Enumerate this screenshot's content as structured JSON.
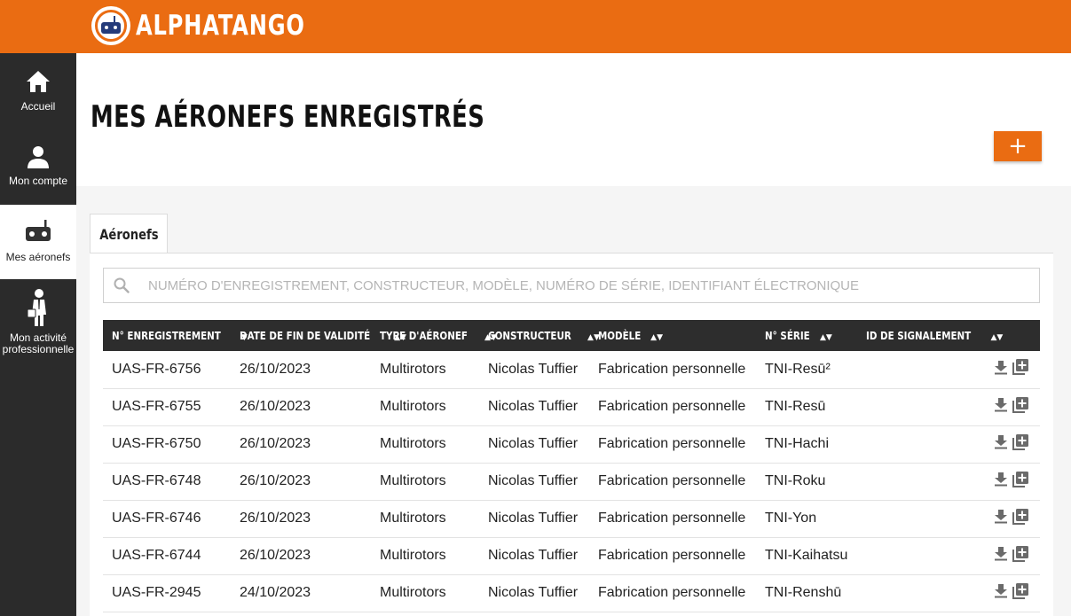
{
  "header": {
    "brand": "ALPHATANGO"
  },
  "sidebar": {
    "items": [
      {
        "label": "Accueil",
        "icon": "home-icon"
      },
      {
        "label": "Mon compte",
        "icon": "user-icon"
      },
      {
        "label": "Mes aéronefs",
        "icon": "drone-controller-icon",
        "active": true
      },
      {
        "label_line1": "Mon activité",
        "label_line2": "professionnelle",
        "icon": "businessman-icon"
      }
    ]
  },
  "page": {
    "title": "MES AÉRONEFS ENREGISTRÉS",
    "add_label": "+"
  },
  "tabs": [
    {
      "label": "Aéronefs"
    }
  ],
  "search": {
    "placeholder": "NUMÉRO D'ENREGISTREMENT, CONSTRUCTEUR, MODÈLE, NUMÉRO DE SÉRIE, IDENTIFIANT ÉLECTRONIQUE"
  },
  "table": {
    "columns": [
      {
        "label": "N° ENREGISTREMENT",
        "sort": "▼"
      },
      {
        "label": "DATE DE FIN DE VALIDITÉ",
        "sort": "▲▼"
      },
      {
        "label": "TYPE D'AÉRONEF",
        "sort": "▲▼"
      },
      {
        "label": "CONSTRUCTEUR",
        "sort": "▲▼"
      },
      {
        "label": "MODÈLE",
        "sort": "▲▼"
      },
      {
        "label": "N° SÉRIE",
        "sort": "▲▼"
      },
      {
        "label": "ID DE SIGNALEMENT",
        "sort": "▲▼"
      }
    ],
    "rows": [
      [
        "UAS-FR-6756",
        "26/10/2023",
        "Multirotors",
        "Nicolas Tuffier",
        "Fabrication personnelle",
        "TNI-Resū²",
        ""
      ],
      [
        "UAS-FR-6755",
        "26/10/2023",
        "Multirotors",
        "Nicolas Tuffier",
        "Fabrication personnelle",
        "TNI-Resū",
        ""
      ],
      [
        "UAS-FR-6750",
        "26/10/2023",
        "Multirotors",
        "Nicolas Tuffier",
        "Fabrication personnelle",
        "TNI-Hachi",
        ""
      ],
      [
        "UAS-FR-6748",
        "26/10/2023",
        "Multirotors",
        "Nicolas Tuffier",
        "Fabrication personnelle",
        "TNI-Roku",
        ""
      ],
      [
        "UAS-FR-6746",
        "26/10/2023",
        "Multirotors",
        "Nicolas Tuffier",
        "Fabrication personnelle",
        "TNI-Yon",
        ""
      ],
      [
        "UAS-FR-6744",
        "26/10/2023",
        "Multirotors",
        "Nicolas Tuffier",
        "Fabrication personnelle",
        "TNI-Kaihatsu",
        ""
      ],
      [
        "UAS-FR-2945",
        "24/10/2023",
        "Multirotors",
        "Nicolas Tuffier",
        "Fabrication personnelle",
        "TNI-Renshū",
        ""
      ]
    ],
    "row_actions": [
      "download-icon",
      "duplicate-icon"
    ]
  },
  "colors": {
    "accent": "#ea6c12",
    "sidebar": "#2b2b2b",
    "table_header": "#2d2d2d"
  }
}
